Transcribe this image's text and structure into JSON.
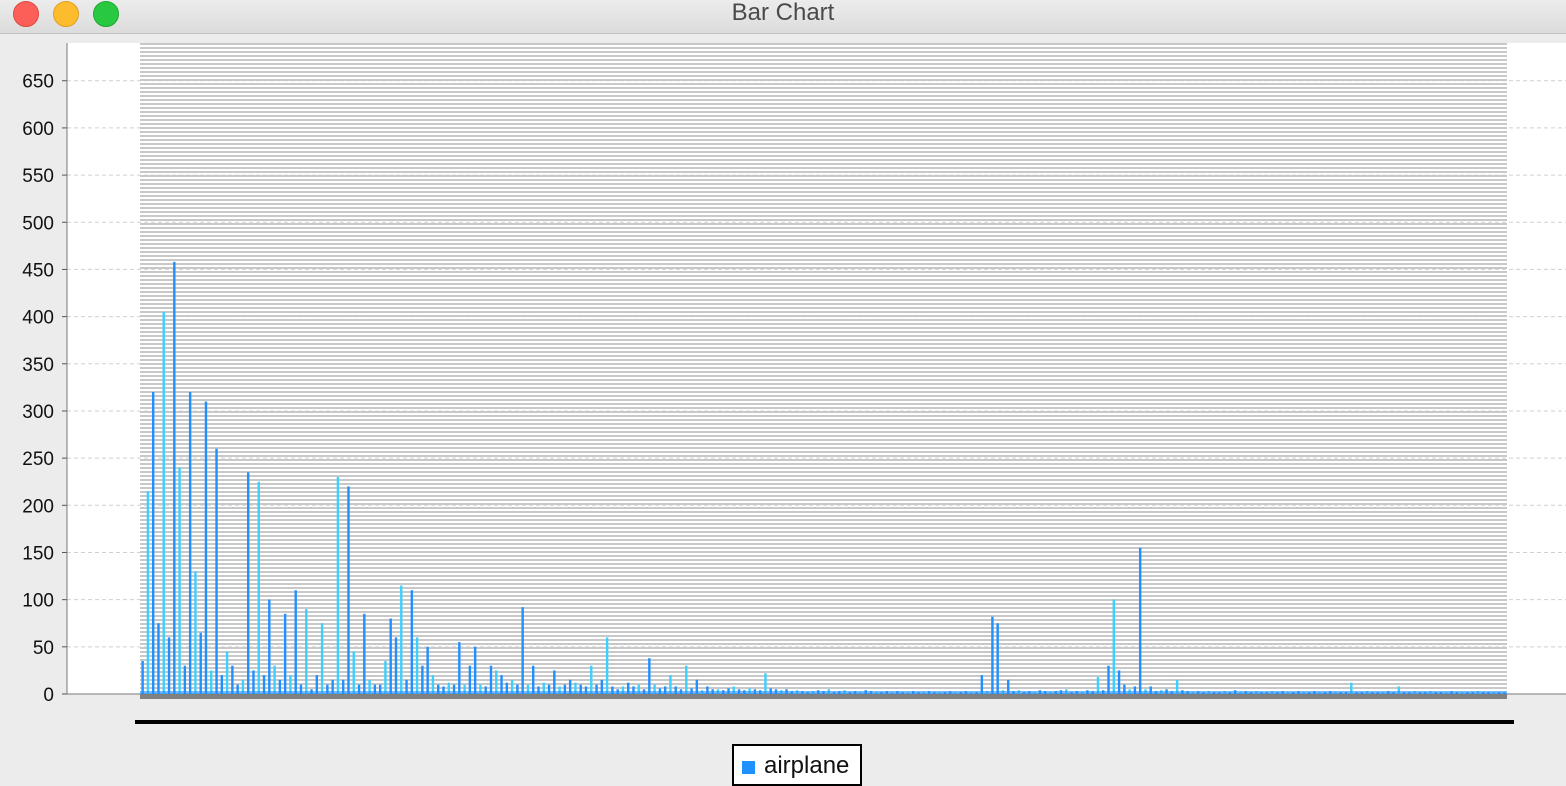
{
  "window": {
    "title": "Bar Chart",
    "buttons": [
      "close",
      "minimize",
      "zoom"
    ]
  },
  "colors": {
    "series_primary": "#1e90ff",
    "series_light": "#3ad0ff",
    "plot_background": "#ffffff",
    "window_background": "#ececec",
    "band_stripe": "#c8c8c8"
  },
  "legend": {
    "label": "airplane",
    "placement": "bottom-center"
  },
  "chart_data": {
    "type": "bar",
    "title": "",
    "xlabel": "",
    "ylabel": "",
    "ylim": [
      0,
      690
    ],
    "y_ticks": [
      0,
      50,
      100,
      150,
      200,
      250,
      300,
      350,
      400,
      450,
      500,
      550,
      600,
      650
    ],
    "grid": true,
    "legend_placement": "bottom",
    "series": [
      {
        "name": "airplane",
        "values": [
          35,
          215,
          320,
          75,
          405,
          60,
          458,
          240,
          30,
          320,
          130,
          65,
          310,
          25,
          260,
          20,
          45,
          30,
          10,
          15,
          235,
          25,
          225,
          20,
          100,
          30,
          15,
          85,
          20,
          110,
          10,
          90,
          5,
          20,
          75,
          10,
          15,
          230,
          15,
          220,
          45,
          10,
          85,
          15,
          10,
          10,
          35,
          80,
          60,
          115,
          15,
          110,
          60,
          30,
          50,
          20,
          10,
          8,
          12,
          10,
          55,
          10,
          30,
          50,
          10,
          8,
          30,
          25,
          20,
          12,
          15,
          10,
          92,
          10,
          30,
          8,
          12,
          10,
          25,
          8,
          10,
          15,
          12,
          10,
          8,
          30,
          10,
          15,
          60,
          8,
          5,
          8,
          12,
          8,
          10,
          5,
          38,
          10,
          6,
          8,
          20,
          8,
          5,
          30,
          6,
          15,
          4,
          8,
          5,
          5,
          4,
          6,
          8,
          5,
          4,
          6,
          5,
          4,
          22,
          6,
          5,
          4,
          5,
          3,
          4,
          3,
          2,
          3,
          4,
          3,
          5,
          2,
          3,
          4,
          2,
          3,
          2,
          4,
          3,
          2,
          2,
          3,
          2,
          3,
          2,
          2,
          3,
          2,
          2,
          3,
          2,
          2,
          2,
          3,
          2,
          2,
          3,
          2,
          2,
          20,
          3,
          82,
          75,
          4,
          15,
          3,
          4,
          2,
          3,
          2,
          4,
          3,
          2,
          3,
          4,
          5,
          2,
          3,
          2,
          4,
          3,
          18,
          4,
          30,
          100,
          25,
          10,
          5,
          8,
          155,
          5,
          8,
          3,
          4,
          5,
          3,
          15,
          4,
          3,
          2,
          3,
          2,
          3,
          2,
          2,
          3,
          2,
          4,
          2,
          3,
          2,
          3,
          2,
          2,
          3,
          2,
          3,
          2,
          2,
          3,
          2,
          2,
          3,
          2,
          2,
          3,
          2,
          2,
          2,
          12,
          2,
          2,
          3,
          2,
          2,
          2,
          3,
          2,
          8,
          2,
          2,
          3,
          2,
          2,
          3,
          2,
          2,
          2,
          3,
          2,
          2,
          2,
          2,
          3,
          2,
          2,
          2,
          2,
          2
        ]
      }
    ]
  }
}
